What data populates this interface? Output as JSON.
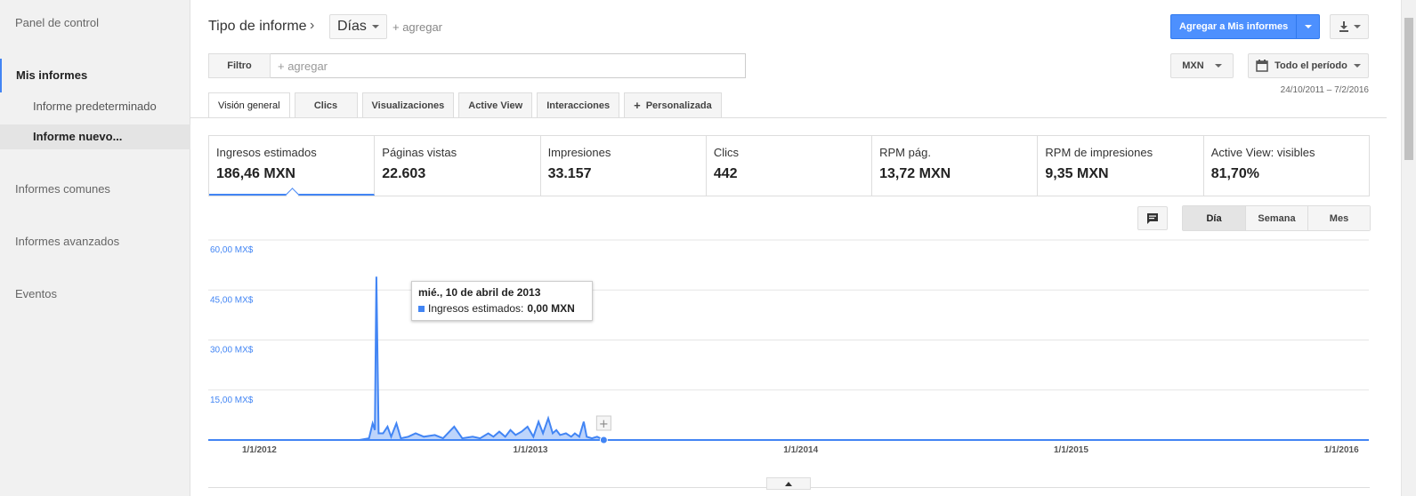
{
  "sidebar": {
    "dashboard": "Panel de control",
    "my_reports": "Mis informes",
    "default_report": "Informe predeterminado",
    "new_report": "Informe nuevo...",
    "common_reports": "Informes comunes",
    "advanced_reports": "Informes avanzados",
    "events": "Eventos"
  },
  "header": {
    "report_type": "Tipo de informe",
    "dimension": "Días",
    "add_dimension": "+ agregar",
    "add_to_my_reports": "Agregar a Mis informes"
  },
  "filter": {
    "label": "Filtro",
    "placeholder": "+ agregar"
  },
  "controls": {
    "currency": "MXN",
    "period": "Todo el período",
    "date_range": "24/10/2011 – 7/2/2016"
  },
  "tabs": [
    {
      "label": "Visión general"
    },
    {
      "label": "Clics"
    },
    {
      "label": "Visualizaciones"
    },
    {
      "label": "Active View"
    },
    {
      "label": "Interacciones"
    },
    {
      "label": "Personalizada"
    }
  ],
  "metrics": [
    {
      "label": "Ingresos estimados",
      "value": "186,46 MXN"
    },
    {
      "label": "Páginas vistas",
      "value": "22.603"
    },
    {
      "label": "Impresiones",
      "value": "33.157"
    },
    {
      "label": "Clics",
      "value": "442"
    },
    {
      "label": "RPM pág.",
      "value": "13,72 MXN"
    },
    {
      "label": "RPM de impresiones",
      "value": "9,35 MXN"
    },
    {
      "label": "Active View: visibles",
      "value": "81,70%"
    }
  ],
  "granularity": {
    "day": "Día",
    "week": "Semana",
    "month": "Mes"
  },
  "tooltip": {
    "date": "mié., 10 de abril de 2013",
    "series": "Ingresos estimados:",
    "value": "0,00 MXN"
  },
  "colors": {
    "accent": "#4285f4",
    "button_blue": "#4d90fe"
  },
  "chart_data": {
    "type": "area",
    "series": [
      {
        "name": "Ingresos estimados",
        "color": "#4285f4"
      }
    ],
    "y_tick_labels": [
      "15,00 MX$",
      "30,00 MX$",
      "45,00 MX$",
      "60,00 MX$"
    ],
    "ylim": [
      0,
      60
    ],
    "x_tick_labels": [
      "1/1/2012",
      "1/1/2013",
      "1/1/2014",
      "1/1/2015",
      "1/1/2016"
    ],
    "xlim": [
      "2011-10-24",
      "2016-02-07"
    ],
    "points": [
      [
        "2012-05-15",
        0
      ],
      [
        "2012-05-28",
        0.5
      ],
      [
        "2012-06-02",
        5
      ],
      [
        "2012-06-05",
        3
      ],
      [
        "2012-06-07",
        49
      ],
      [
        "2012-06-10",
        2
      ],
      [
        "2012-06-16",
        2
      ],
      [
        "2012-06-22",
        4
      ],
      [
        "2012-06-27",
        1
      ],
      [
        "2012-07-04",
        5
      ],
      [
        "2012-07-10",
        0.5
      ],
      [
        "2012-07-20",
        1
      ],
      [
        "2012-07-30",
        2
      ],
      [
        "2012-08-10",
        1
      ],
      [
        "2012-08-25",
        1.5
      ],
      [
        "2012-09-05",
        0.5
      ],
      [
        "2012-09-20",
        4
      ],
      [
        "2012-10-01",
        0.5
      ],
      [
        "2012-10-15",
        1
      ],
      [
        "2012-10-25",
        0.5
      ],
      [
        "2012-11-05",
        2
      ],
      [
        "2012-11-12",
        1
      ],
      [
        "2012-11-20",
        2.5
      ],
      [
        "2012-11-28",
        1
      ],
      [
        "2012-12-05",
        3
      ],
      [
        "2012-12-12",
        1.5
      ],
      [
        "2012-12-20",
        2.5
      ],
      [
        "2012-12-28",
        4
      ],
      [
        "2013-01-05",
        1
      ],
      [
        "2013-01-12",
        5.5
      ],
      [
        "2013-01-18",
        2
      ],
      [
        "2013-01-25",
        6.5
      ],
      [
        "2013-01-31",
        2
      ],
      [
        "2013-02-05",
        3
      ],
      [
        "2013-02-10",
        1.5
      ],
      [
        "2013-02-18",
        2
      ],
      [
        "2013-02-25",
        1
      ],
      [
        "2013-03-02",
        2
      ],
      [
        "2013-03-08",
        1
      ],
      [
        "2013-03-14",
        5.5
      ],
      [
        "2013-03-18",
        1
      ],
      [
        "2013-03-25",
        0.5
      ],
      [
        "2013-04-01",
        1
      ],
      [
        "2013-04-10",
        0
      ]
    ],
    "highlighted_point": [
      "2013-04-10",
      0
    ]
  }
}
